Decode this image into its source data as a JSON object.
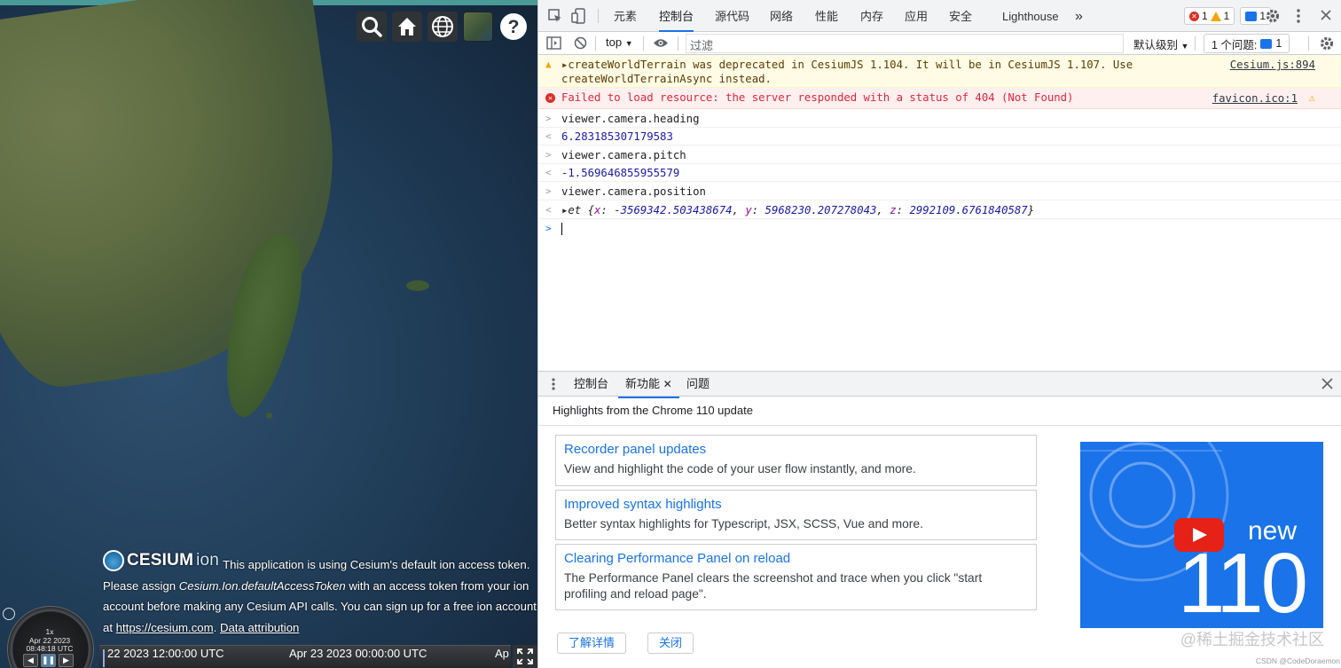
{
  "viewer": {
    "toolbar": [
      "search-icon",
      "home-icon",
      "globe-icon",
      "imagery-layer-icon",
      "help-icon"
    ],
    "credit": {
      "logo_main": "CESIUM",
      "logo_sub": "ion",
      "text_1": "This application is using Cesium's default ion access token. Please assign ",
      "code": "Cesium.Ion.defaultAccessToken",
      "text_2": " with an access token from your ion account before making any Cesium API calls. You can sign up for a free ion account at ",
      "link": "https://cesium.com",
      "text_3": ". ",
      "attribution": "Data attribution"
    },
    "animation": {
      "speed": "1x",
      "date": "Apr 22 2023",
      "time": "08:48:18 UTC",
      "buttons": [
        "◀",
        "❚❚",
        "▶"
      ]
    },
    "timeline": {
      "label_1": "22 2023 12:00:00 UTC",
      "label_2": "Apr 23 2023 00:00:00 UTC",
      "label_3": "Ap"
    }
  },
  "devtools": {
    "tabs": [
      "元素",
      "控制台",
      "源代码",
      "网络",
      "性能",
      "内存",
      "应用",
      "安全",
      "Lighthouse"
    ],
    "active_tab": "控制台",
    "more": "»",
    "counters": {
      "errors": "1",
      "warnings": "1",
      "messages": "1"
    },
    "filter": {
      "context": "top",
      "placeholder": "过滤",
      "levels": "默认级别",
      "issues_label": "1 个问题:",
      "issues_count": "1"
    },
    "console": {
      "warning": {
        "text_1": "createWorldTerrain was deprecated in CesiumJS 1.104.  It will be in CesiumJS 1.107.  Use",
        "text_2": "createWorldTerrainAsync instead.",
        "source": "Cesium.js:894"
      },
      "error": {
        "text": "Failed to load resource: the server responded with a status of 404 (Not Found)",
        "source": "favicon.ico:1"
      },
      "entries": [
        {
          "input": "viewer.camera.heading",
          "output": "6.283185307179583"
        },
        {
          "input": "viewer.camera.pitch",
          "output": "-1.569646855955579"
        },
        {
          "input": "viewer.camera.position"
        }
      ],
      "object": {
        "name": "et",
        "x_key": "x",
        "x_val": "-3569342.503438674",
        "y_key": "y",
        "y_val": "5968230.207278043",
        "z_key": "z",
        "z_val": "2992109.6761840587"
      }
    },
    "drawer": {
      "tabs": [
        "控制台",
        "新功能",
        "问题"
      ],
      "active": "新功能",
      "heading": "Highlights from the Chrome 110 update",
      "cards": [
        {
          "title": "Recorder panel updates",
          "desc": "View and highlight the code of your user flow instantly, and more."
        },
        {
          "title": "Improved syntax highlights",
          "desc": "Better syntax highlights for Typescript, JSX, SCSS, Vue and more."
        },
        {
          "title": "Clearing Performance Panel on reload",
          "desc": "The Performance Panel clears the screenshot and trace when you click \"start profiling and reload page\"."
        }
      ],
      "video": {
        "word": "new",
        "number": "110"
      },
      "learn_more": "了解详情",
      "close": "关闭"
    },
    "watermark": "@稀土掘金技术社区",
    "watermark_small": "CSDN @CodeDoraemon"
  }
}
